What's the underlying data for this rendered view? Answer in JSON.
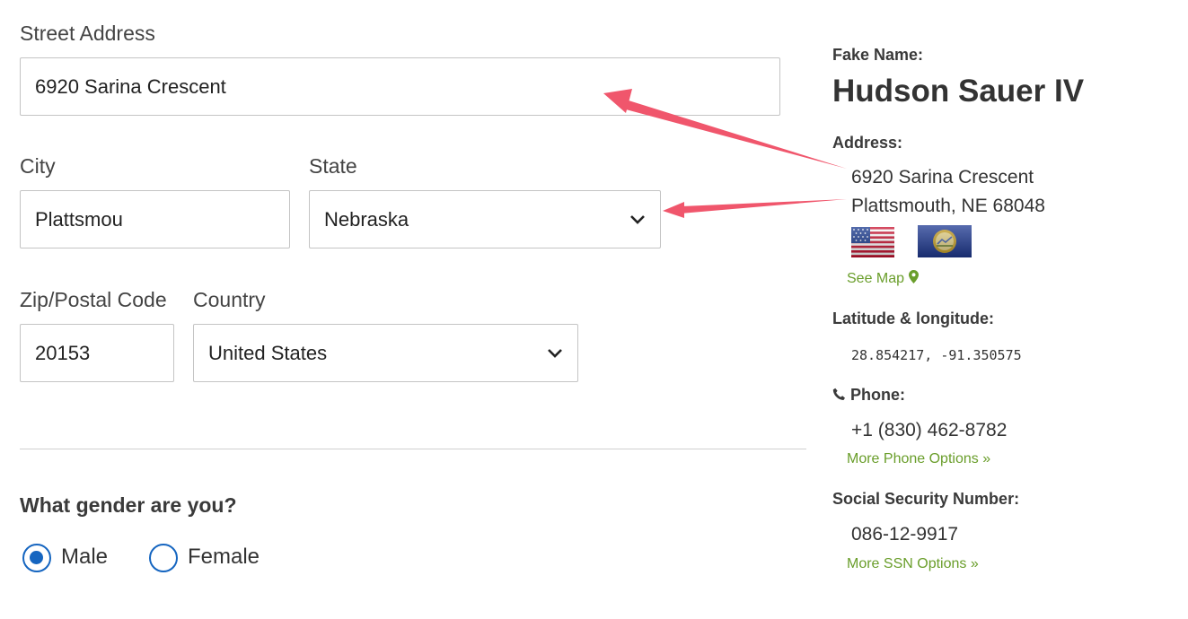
{
  "form": {
    "street_label": "Street Address",
    "street_value": "6920 Sarina Crescent",
    "city_label": "City",
    "city_value": "Plattsmou",
    "state_label": "State",
    "state_value": "Nebraska",
    "zip_label": "Zip/Postal Code",
    "zip_value": "20153",
    "country_label": "Country",
    "country_value": "United States",
    "gender_question": "What gender are you?",
    "gender_options": [
      {
        "label": "Male",
        "selected": true
      },
      {
        "label": "Female",
        "selected": false
      }
    ]
  },
  "sidebar": {
    "name_heading": "Fake Name:",
    "name": "Hudson Sauer IV",
    "address_heading": "Address:",
    "address_line1": "6920 Sarina Crescent",
    "address_line2": "Plattsmouth, NE 68048",
    "flags": [
      "us-flag",
      "nebraska-flag"
    ],
    "see_map": "See Map",
    "latlong_heading": "Latitude & longitude:",
    "latlong": "28.854217, -91.350575",
    "phone_heading": "Phone:",
    "phone": "+1 (830) 462-8782",
    "more_phone": "More Phone Options »",
    "ssn_heading": "Social Security Number:",
    "ssn": "086-12-9917",
    "more_ssn": "More SSN Options »"
  },
  "colors": {
    "accent": "#1565c0",
    "link": "#6a9e2b",
    "arrow": "#f0566c"
  }
}
